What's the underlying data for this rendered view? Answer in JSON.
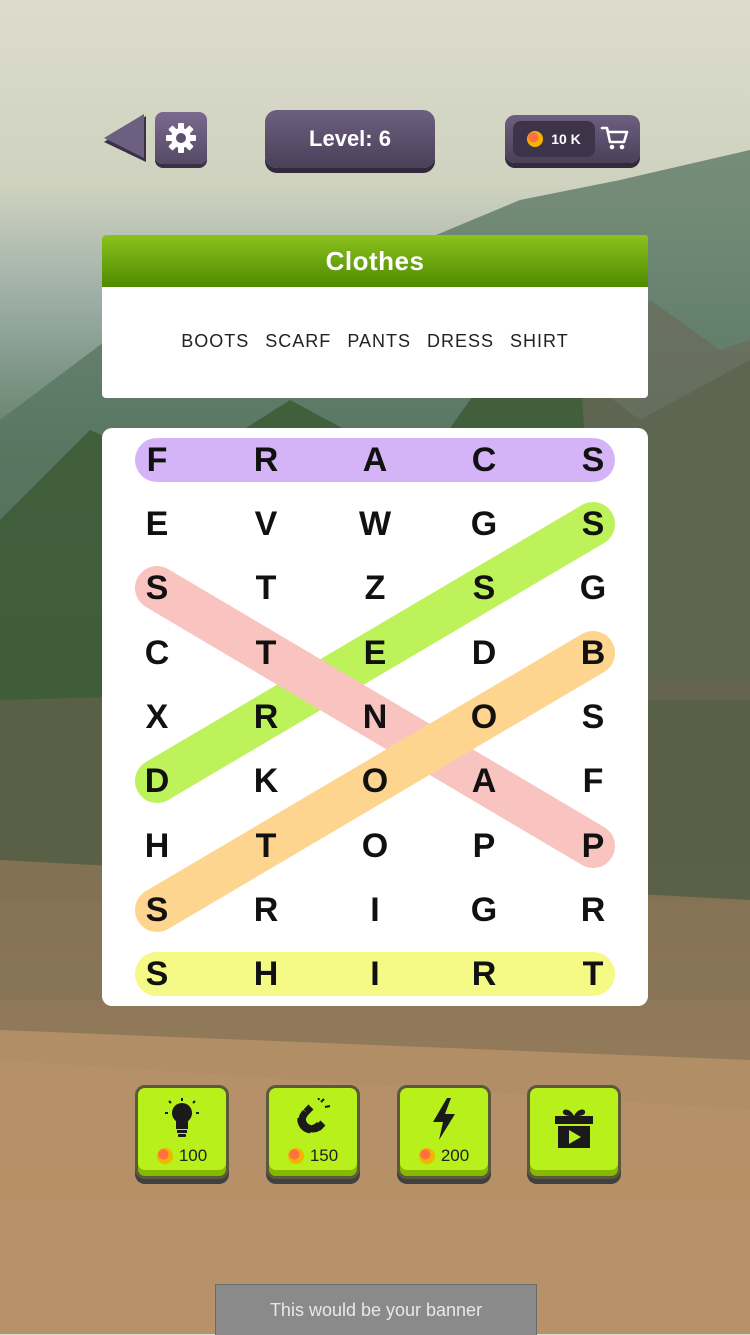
{
  "top_bar": {
    "level_text": "Level: 6",
    "coins_text": "10 K"
  },
  "category": {
    "title": "Clothes",
    "words": [
      "BOOTS",
      "SCARF",
      "PANTS",
      "DRESS",
      "SHIRT"
    ]
  },
  "grid": {
    "rows": [
      [
        "F",
        "R",
        "A",
        "C",
        "S"
      ],
      [
        "E",
        "V",
        "W",
        "G",
        "S"
      ],
      [
        "S",
        "T",
        "Z",
        "S",
        "G"
      ],
      [
        "C",
        "T",
        "E",
        "D",
        "B"
      ],
      [
        "X",
        "R",
        "N",
        "O",
        "S"
      ],
      [
        "D",
        "K",
        "O",
        "A",
        "F"
      ],
      [
        "H",
        "T",
        "O",
        "P",
        "P"
      ],
      [
        "S",
        "R",
        "I",
        "G",
        "R"
      ],
      [
        "S",
        "H",
        "I",
        "R",
        "T"
      ]
    ],
    "found_highlights": [
      {
        "word": "SCARF",
        "from": [
          0,
          4
        ],
        "to": [
          0,
          0
        ],
        "color": "#d4b3f7"
      },
      {
        "word": "DRESS",
        "from": [
          5,
          0
        ],
        "to": [
          1,
          4
        ],
        "color": "#bdf25a"
      },
      {
        "word": "PANTS",
        "from": [
          6,
          4
        ],
        "to": [
          2,
          0
        ],
        "color": "#f9c4bf"
      },
      {
        "word": "BOOTS",
        "from": [
          3,
          4
        ],
        "to": [
          7,
          0
        ],
        "color": "#fdd58e"
      },
      {
        "word": "SHIRT",
        "from": [
          8,
          0
        ],
        "to": [
          8,
          4
        ],
        "color": "#f5f985"
      }
    ]
  },
  "powerups": [
    {
      "icon": "lightbulb-icon",
      "cost": "100"
    },
    {
      "icon": "magnet-icon",
      "cost": "150"
    },
    {
      "icon": "lightning-icon",
      "cost": "200"
    },
    {
      "icon": "gift-video-icon",
      "cost": ""
    }
  ],
  "banner": {
    "text": "This would be your banner"
  }
}
